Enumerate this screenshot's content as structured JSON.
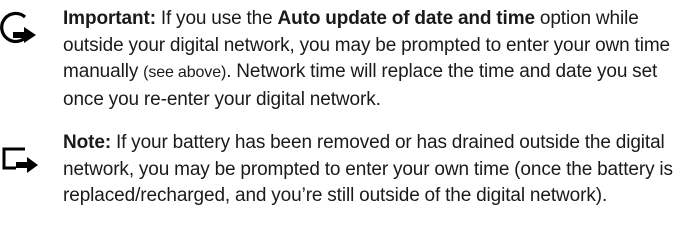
{
  "important": {
    "icon": "important-arrow-icon",
    "label": "Important:",
    "text_before": " If you use the ",
    "emphasis": "Auto update of date and time",
    "text_middle": " option while outside your digital network, you may be prompted to enter your own time manually ",
    "aside": "(see above)",
    "text_after": ". Network time will replace the time and date you set once you re-enter your digital network."
  },
  "note": {
    "icon": "note-arrow-icon",
    "label": "Note:",
    "text": " If your battery has been removed or has drained outside the digital network, you may be prompted to enter your own time (once the battery is replaced/recharged, and you’re still outside of the digital network)."
  },
  "colors": {
    "text": "#1a1a1a",
    "icon": "#000000",
    "background": "#ffffff"
  }
}
